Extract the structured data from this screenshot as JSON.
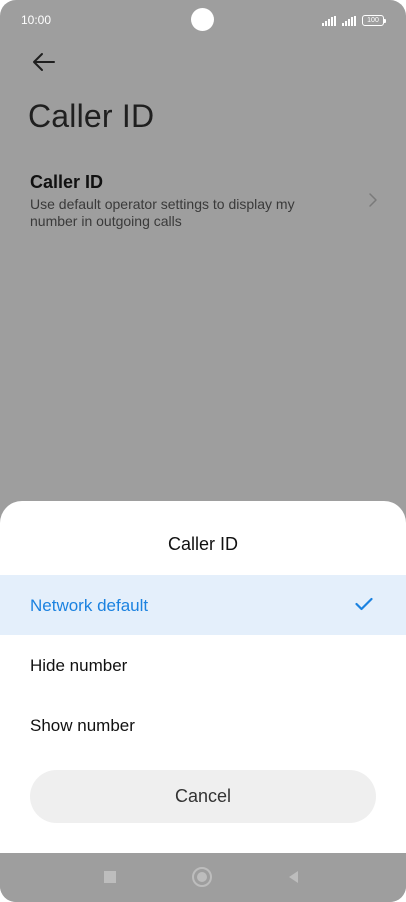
{
  "status_bar": {
    "time": "10:00",
    "battery": "100"
  },
  "header": {
    "back_icon": "arrow-left-icon",
    "title": "Caller ID"
  },
  "setting": {
    "title": "Caller ID",
    "description": "Use default operator settings to display my number in outgoing calls",
    "chevron_icon": "chevron-right-icon"
  },
  "sheet": {
    "title": "Caller ID",
    "options": [
      {
        "label": "Network default",
        "selected": true
      },
      {
        "label": "Hide number",
        "selected": false
      },
      {
        "label": "Show number",
        "selected": false
      }
    ],
    "check_icon": "checkmark-icon",
    "cancel_label": "Cancel"
  },
  "nav": {
    "recents_icon": "square-recents-icon",
    "home_icon": "circle-home-icon",
    "back_icon": "triangle-back-icon"
  },
  "colors": {
    "accent": "#1b82e0",
    "selected_bg": "#e4effb",
    "scrim": "#9e9e9e"
  }
}
